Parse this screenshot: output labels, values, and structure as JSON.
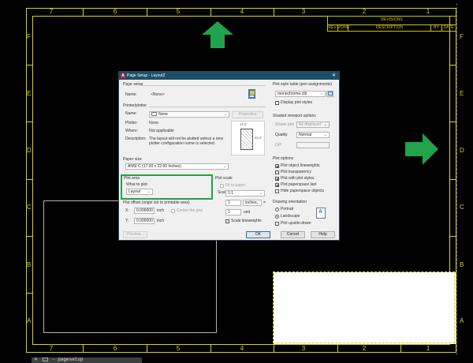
{
  "drawing": {
    "zones_top": [
      "7",
      "6",
      "5",
      "4",
      "3",
      "2",
      "1"
    ],
    "zones_bottom": [
      "7",
      "6",
      "5",
      "4",
      "3",
      "2",
      "1"
    ],
    "zones_left": [
      "F",
      "E",
      "D",
      "C",
      "B",
      "A"
    ],
    "zones_right": [
      "F",
      "E",
      "D",
      "C",
      "B",
      "A"
    ],
    "revisions_title": "REVISIONS",
    "revisions_columns": [
      "REV.",
      "ZONE",
      "DESCRIPTION",
      "BY",
      "DATE"
    ],
    "colors": {
      "border": "#d8d41a",
      "arrow": "#22a24a",
      "highlight": "#22a24a"
    }
  },
  "dialog": {
    "title": "Page Setup - Layout2",
    "page_setup": {
      "group": "Page setup",
      "name_label": "Name:",
      "name_value": "<None>"
    },
    "printer": {
      "group": "Printer/plotter",
      "name_label": "Name:",
      "name_value": "None",
      "properties_label": "Properties",
      "plotter_label": "Plotter:",
      "plotter_value": "None",
      "where_label": "Where:",
      "where_value": "Not applicable",
      "description_label": "Description:",
      "description_value": "The layout will not be plotted unless a new plotter configuration name is selected.",
      "preview_width": "17.0\"",
      "preview_height": "22.0\""
    },
    "paper_size": {
      "group": "Paper size",
      "value": "ANSI C (17.00 x 22.00 Inches)"
    },
    "plot_area": {
      "group": "Plot area",
      "what_label": "What to plot:",
      "what_value": "Layout"
    },
    "plot_offset": {
      "group": "Plot offset (origin set to printable area)",
      "x_label": "X:",
      "x_value": "0.000000",
      "x_unit": "inch",
      "y_label": "Y:",
      "y_value": "0.000000",
      "y_unit": "inch",
      "center_label": "Center the plot"
    },
    "plot_scale": {
      "group": "Plot scale",
      "fit_label": "Fit to paper",
      "scale_label": "Scale:",
      "scale_value": "1:1",
      "value1": "1",
      "unit1": "inches",
      "value2": "1",
      "unit2": "unit",
      "lineweights_label": "Scale lineweights"
    },
    "plot_style": {
      "group": "Plot style table (pen assignments)",
      "value": "monochrome.ctb",
      "display_label": "Display plot styles"
    },
    "shaded": {
      "group": "Shaded viewport options",
      "shade_label": "Shade plot",
      "shade_value": "As displayed",
      "quality_label": "Quality",
      "quality_value": "Normal",
      "dpi_label": "DPI"
    },
    "plot_options": {
      "group": "Plot options",
      "items": [
        {
          "label": "Plot object lineweights",
          "checked": true
        },
        {
          "label": "Plot transparency",
          "checked": false
        },
        {
          "label": "Plot with plot styles",
          "checked": true
        },
        {
          "label": "Plot paperspace last",
          "checked": true
        },
        {
          "label": "Hide paperspace objects",
          "checked": false
        }
      ]
    },
    "orientation": {
      "group": "Drawing orientation",
      "portrait": "Portrait",
      "landscape": "Landscape",
      "upside": "Plot upside-down",
      "preview_letter": "A"
    },
    "buttons": {
      "preview": "Preview...",
      "ok": "OK",
      "cancel": "Cancel",
      "help": "Help"
    }
  },
  "command_line": {
    "value": "- pagesetup"
  }
}
